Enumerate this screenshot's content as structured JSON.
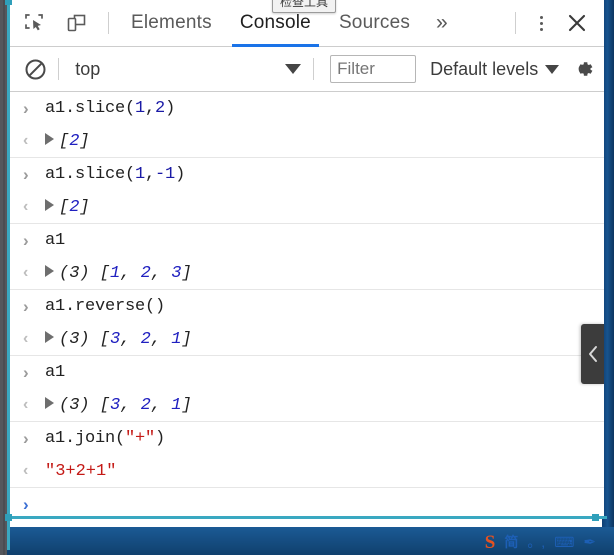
{
  "tooltip": {
    "text": "检查工具"
  },
  "toolbar": {
    "inspect_icon": "inspect-element-icon",
    "device_icon": "device-toolbar-icon",
    "overflow_label": "»",
    "more_label": "more-options-icon",
    "close_label": "×"
  },
  "tabs": [
    {
      "label": "Elements",
      "active": false
    },
    {
      "label": "Console",
      "active": true
    },
    {
      "label": "Sources",
      "active": false
    }
  ],
  "filterbar": {
    "clear_icon": "clear-console-icon",
    "context": "top",
    "context_caret": "▼",
    "filter_placeholder": "Filter",
    "filter_value": "",
    "levels_label": "Default levels",
    "levels_caret": "▼",
    "settings_icon": "gear-icon"
  },
  "console": {
    "input_marker": "›",
    "output_marker": "‹",
    "entries": [
      {
        "kind": "input",
        "segments": [
          {
            "text": "a1.slice(",
            "cls": "plain"
          },
          {
            "text": "1",
            "cls": "num"
          },
          {
            "text": ",",
            "cls": "plain"
          },
          {
            "text": "2",
            "cls": "num"
          },
          {
            "text": ")",
            "cls": "plain"
          }
        ]
      },
      {
        "kind": "output",
        "expandable": true,
        "segments": [
          {
            "text": "[",
            "cls": "plain"
          },
          {
            "text": "2",
            "cls": "num"
          },
          {
            "text": "]",
            "cls": "plain"
          }
        ]
      },
      {
        "kind": "input",
        "segments": [
          {
            "text": "a1.slice(",
            "cls": "plain"
          },
          {
            "text": "1",
            "cls": "num"
          },
          {
            "text": ",",
            "cls": "plain"
          },
          {
            "text": "-1",
            "cls": "num"
          },
          {
            "text": ")",
            "cls": "plain"
          }
        ]
      },
      {
        "kind": "output",
        "expandable": true,
        "segments": [
          {
            "text": "[",
            "cls": "plain"
          },
          {
            "text": "2",
            "cls": "num"
          },
          {
            "text": "]",
            "cls": "plain"
          }
        ]
      },
      {
        "kind": "input",
        "segments": [
          {
            "text": "a1",
            "cls": "plain"
          }
        ]
      },
      {
        "kind": "output",
        "expandable": true,
        "segments": [
          {
            "text": "(3) [",
            "cls": "plain"
          },
          {
            "text": "1",
            "cls": "num"
          },
          {
            "text": ", ",
            "cls": "plain"
          },
          {
            "text": "2",
            "cls": "num"
          },
          {
            "text": ", ",
            "cls": "plain"
          },
          {
            "text": "3",
            "cls": "num"
          },
          {
            "text": "]",
            "cls": "plain"
          }
        ]
      },
      {
        "kind": "input",
        "segments": [
          {
            "text": "a1.reverse()",
            "cls": "plain"
          }
        ]
      },
      {
        "kind": "output",
        "expandable": true,
        "segments": [
          {
            "text": "(3) [",
            "cls": "plain"
          },
          {
            "text": "3",
            "cls": "num"
          },
          {
            "text": ", ",
            "cls": "plain"
          },
          {
            "text": "2",
            "cls": "num"
          },
          {
            "text": ", ",
            "cls": "plain"
          },
          {
            "text": "1",
            "cls": "num"
          },
          {
            "text": "]",
            "cls": "plain"
          }
        ]
      },
      {
        "kind": "input",
        "segments": [
          {
            "text": "a1",
            "cls": "plain"
          }
        ]
      },
      {
        "kind": "output",
        "expandable": true,
        "segments": [
          {
            "text": "(3) [",
            "cls": "plain"
          },
          {
            "text": "3",
            "cls": "num"
          },
          {
            "text": ", ",
            "cls": "plain"
          },
          {
            "text": "2",
            "cls": "num"
          },
          {
            "text": ", ",
            "cls": "plain"
          },
          {
            "text": "1",
            "cls": "num"
          },
          {
            "text": "]",
            "cls": "plain"
          }
        ]
      },
      {
        "kind": "input",
        "segments": [
          {
            "text": "a1.join(",
            "cls": "plain"
          },
          {
            "text": "\"+\"",
            "cls": "str"
          },
          {
            "text": ")",
            "cls": "plain"
          }
        ]
      },
      {
        "kind": "output",
        "expandable": false,
        "segments": [
          {
            "text": "\"3+2+1\"",
            "cls": "str"
          }
        ]
      },
      {
        "kind": "prompt",
        "segments": []
      }
    ],
    "collapse_handle": "‹"
  },
  "ime": {
    "logo": "S",
    "mode_label": "简",
    "punct_label": "。,",
    "keyboard_label": "⌨",
    "toolbox_label": "✒"
  },
  "colors": {
    "accent": "#1a73e8",
    "selection": "#3aa8c1",
    "number": "#1a1aa6",
    "string": "#c41a16",
    "taskbar": "#17548f"
  }
}
